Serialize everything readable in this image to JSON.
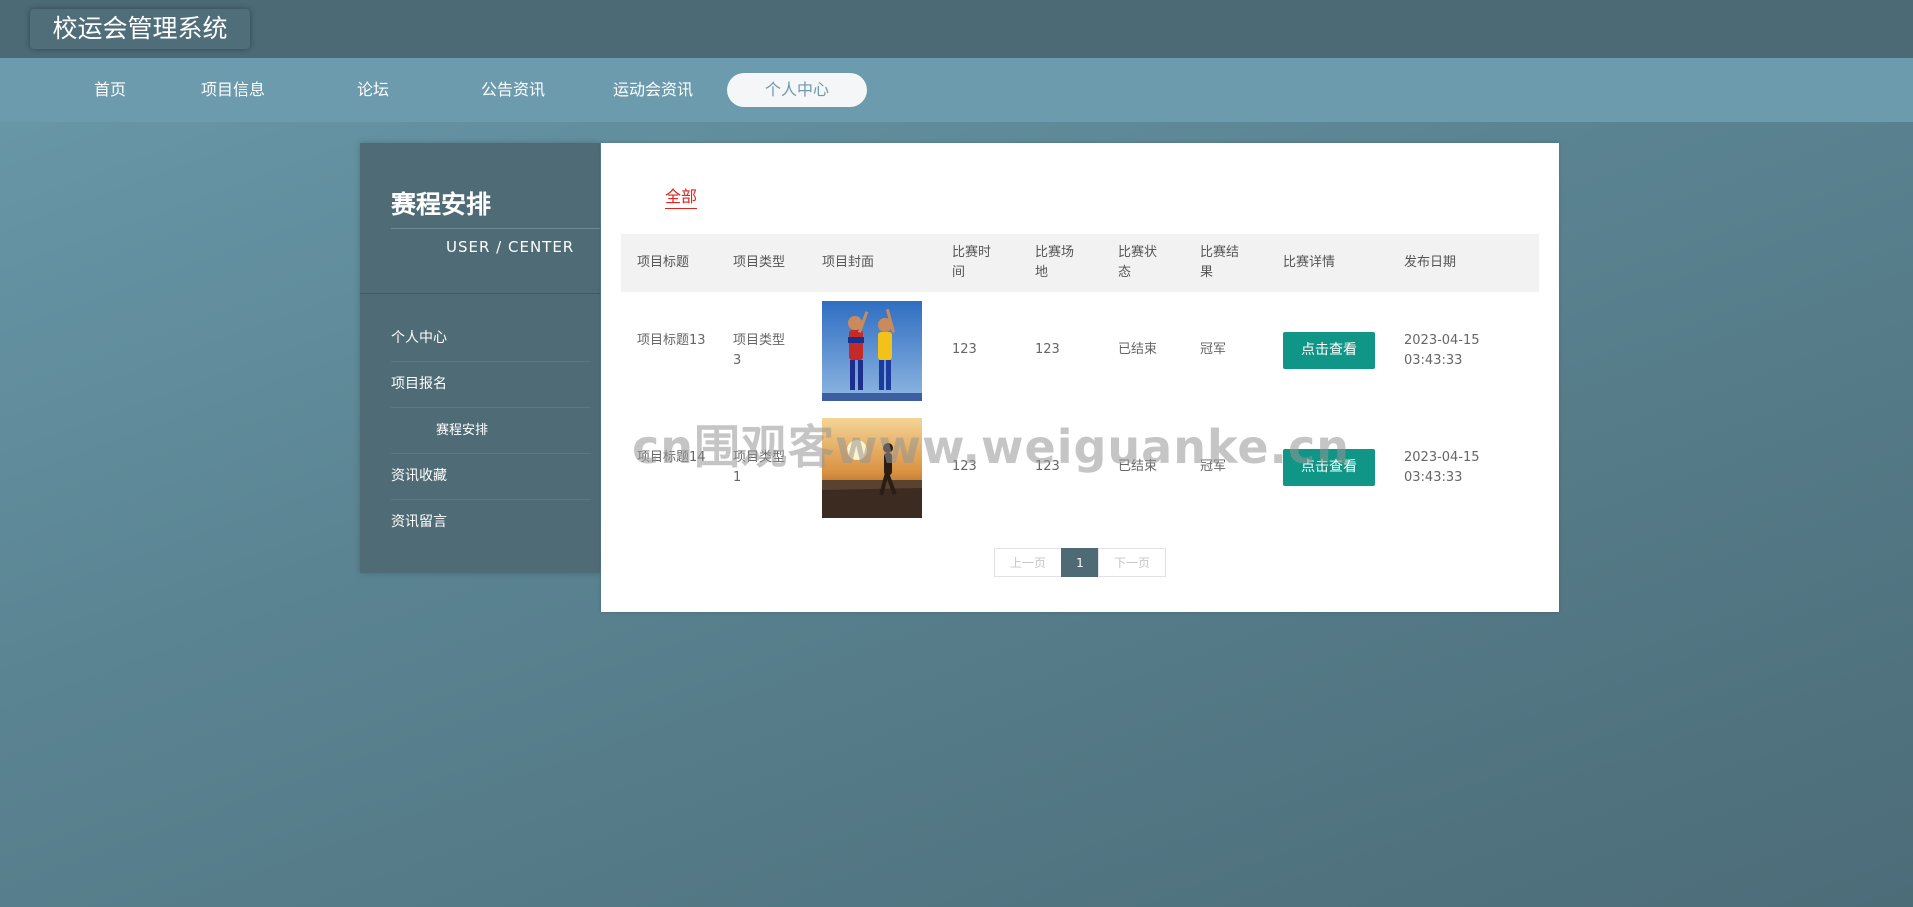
{
  "app": {
    "title": "校运会管理系统"
  },
  "nav": {
    "items": [
      "首页",
      "项目信息",
      "论坛",
      "公告资讯",
      "运动会资讯",
      "个人中心"
    ],
    "active": "个人中心"
  },
  "sidebar": {
    "title": "赛程安排",
    "subtitle": "USER / CENTER",
    "items": [
      "个人中心",
      "项目报名",
      "赛程安排",
      "资讯收藏",
      "资讯留言"
    ]
  },
  "main": {
    "tab": "全部",
    "columns": [
      "项目标题",
      "项目类型",
      "项目封面",
      "比赛时间",
      "比赛场地",
      "比赛状态",
      "比赛结果",
      "比赛详情",
      "发布日期"
    ],
    "rows": [
      {
        "title": "项目标题13",
        "type": "项目类型3",
        "cover": "soccer-players-image",
        "time": "123",
        "venue": "123",
        "status": "已结束",
        "result": "冠军",
        "detail_button": "点击查看",
        "date": "2023-04-15 03:43:33"
      },
      {
        "title": "项目标题14",
        "type": "项目类型1",
        "cover": "runner-sunset-image",
        "time": "123",
        "venue": "123",
        "status": "已结束",
        "result": "冠军",
        "detail_button": "点击查看",
        "date": "2023-04-15 03:43:33"
      }
    ],
    "pagination": {
      "prev": "上一页",
      "current": "1",
      "next": "下一页"
    }
  },
  "watermark": "cn围观客www.weiguanke.cn",
  "colors": {
    "topbar": "#4b6a76",
    "navbar": "#6c9bae",
    "sidebar": "#4f6b75",
    "accent_button": "#0f9686",
    "active_tab_text": "#e0231b"
  }
}
